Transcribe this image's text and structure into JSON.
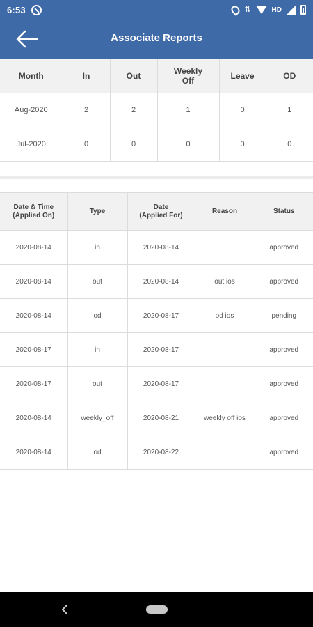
{
  "status_bar": {
    "time": "6:53",
    "network_label": "HD",
    "icons": [
      "sync-icon",
      "location-icon",
      "data-transfer-icon",
      "wifi-icon",
      "signal-icon",
      "battery-icon"
    ]
  },
  "app_bar": {
    "title": "Associate Reports",
    "back_icon": "arrow-left-icon",
    "background_color": "#3f6aa8"
  },
  "summary": {
    "headers": [
      "Month",
      "In",
      "Out",
      "Weekly Off",
      "Leave",
      "OD"
    ],
    "rows": [
      [
        "Aug-2020",
        "2",
        "2",
        "1",
        "0",
        "1"
      ],
      [
        "Jul-2020",
        "0",
        "0",
        "0",
        "0",
        "0"
      ]
    ]
  },
  "details": {
    "headers": [
      [
        "Date & Time",
        "(Applied On)"
      ],
      [
        "Type"
      ],
      [
        "Date",
        "(Applied For)"
      ],
      [
        "Reason"
      ],
      [
        "Status"
      ]
    ],
    "rows": [
      [
        "2020-08-14",
        "in",
        "2020-08-14",
        "",
        "approved"
      ],
      [
        "2020-08-14",
        "out",
        "2020-08-14",
        "out ios",
        "approved"
      ],
      [
        "2020-08-14",
        "od",
        "2020-08-17",
        "od ios",
        "pending"
      ],
      [
        "2020-08-17",
        "in",
        "2020-08-17",
        "",
        "approved"
      ],
      [
        "2020-08-17",
        "out",
        "2020-08-17",
        "",
        "approved"
      ],
      [
        "2020-08-14",
        "weekly_off",
        "2020-08-21",
        "weekly off ios",
        "approved"
      ],
      [
        "2020-08-14",
        "od",
        "2020-08-22",
        "",
        "approved"
      ]
    ]
  },
  "nav_bar": {
    "icons": [
      "nav-back-icon",
      "home-pill-icon"
    ]
  }
}
